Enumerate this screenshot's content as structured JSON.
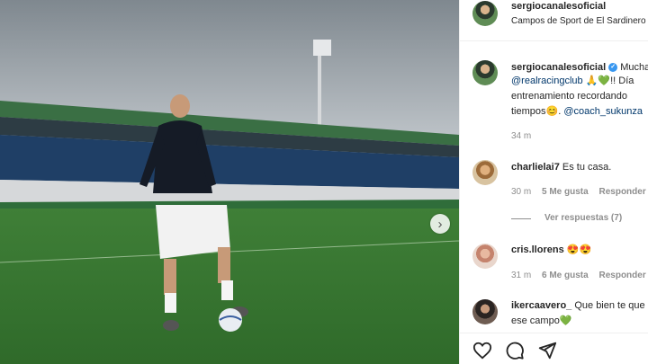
{
  "post": {
    "username": "sergiocanalesoficial",
    "location": "Campos de Sport de El Sardinero",
    "caption_line1_prefix": "Mucha",
    "caption_mention1": "@realracingclub",
    "caption_line2_emojis": "🙏💚",
    "caption_line2_text": "!! Día",
    "caption_line3": "entrenamiento recordando",
    "caption_line4_text": "tiempos😊.",
    "caption_mention2": "@coach_sukunza",
    "caption_time": "34 m"
  },
  "comments": [
    {
      "username": "charlielai7",
      "text": "Es tu casa.",
      "time": "30 m",
      "likes": "5 Me gusta",
      "reply": "Responder",
      "view_replies": "Ver respuestas (7)"
    },
    {
      "username": "cris.llorens",
      "text": "😍😍",
      "time": "31 m",
      "likes": "6 Me gusta",
      "reply": "Responder"
    },
    {
      "username": "ikercaavero_",
      "text_line1": "Que bien te que",
      "text_line2": "ese campo💚"
    }
  ],
  "icons": {
    "next": "chevron-right-icon",
    "like": "heart-icon",
    "comment": "comment-icon",
    "share": "send-icon",
    "verified": "verified-badge-icon"
  },
  "colors": {
    "link": "#00376b",
    "verified": "#3897f0",
    "muted": "#8e8e8e"
  }
}
